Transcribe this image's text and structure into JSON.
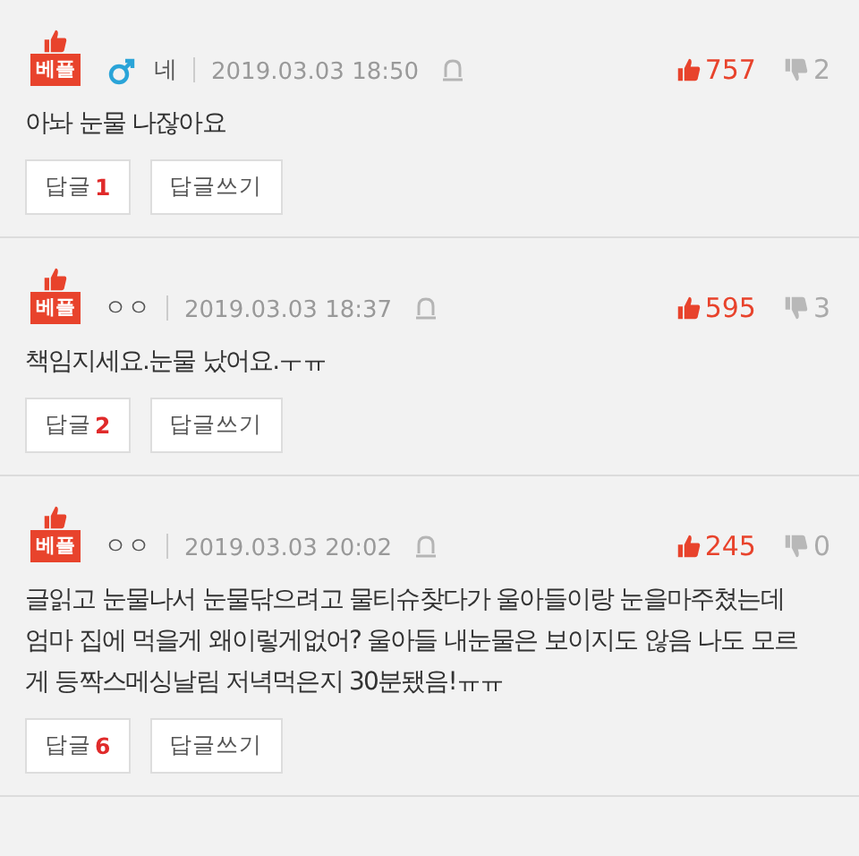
{
  "comments": [
    {
      "badge": "베플",
      "male": true,
      "author": "네",
      "date": "2019.03.03 18:50",
      "likes": "757",
      "dislikes": "2",
      "text": "아놔 눈물 나잖아요",
      "reply_label": "답글",
      "reply_count": "1",
      "write_label": "답글쓰기"
    },
    {
      "badge": "베플",
      "male": false,
      "author": "ㅇㅇ",
      "date": "2019.03.03 18:37",
      "likes": "595",
      "dislikes": "3",
      "text": "책임지세요.눈물 났어요.ㅜㅠ",
      "reply_label": "답글",
      "reply_count": "2",
      "write_label": "답글쓰기"
    },
    {
      "badge": "베플",
      "male": false,
      "author": "ㅇㅇ",
      "date": "2019.03.03 20:02",
      "likes": "245",
      "dislikes": "0",
      "text": "글읽고 눈물나서 눈물닦으려고 물티슈찾다가 울아들이랑 눈을마주쳤는데 엄마 집에 먹을게 왜이렇게없어? 울아들 내눈물은 보이지도 않음 나도 모르게 등짝스메싱날림 저녁먹은지 30분됐음!ㅠㅠ",
      "reply_label": "답글",
      "reply_count": "6",
      "write_label": "답글쓰기"
    }
  ]
}
